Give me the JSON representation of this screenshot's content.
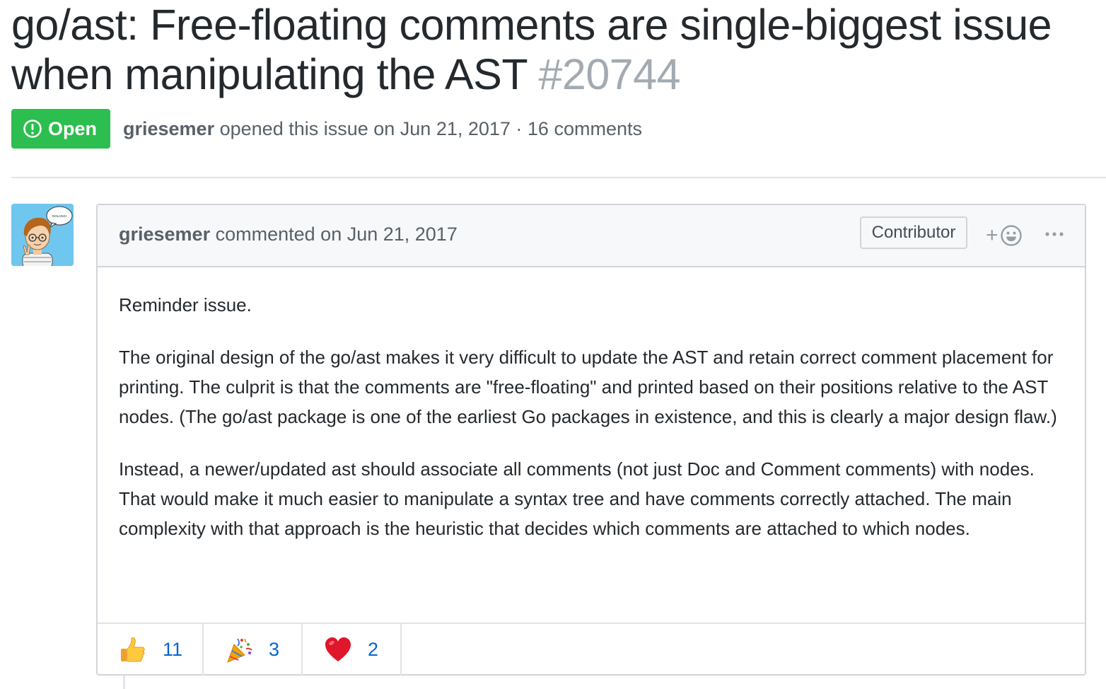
{
  "issue": {
    "title": "go/ast: Free-floating comments are single-biggest issue when manipulating the AST",
    "number": "#20744",
    "state": "Open",
    "author": "griesemer",
    "opened_text": "opened this issue on Jun 21, 2017 · 16 comments"
  },
  "comment": {
    "author": "griesemer",
    "commented_text": "commented on Jun 21, 2017",
    "role": "Contributor",
    "avatar_text": "GOLANG!",
    "add_reaction_label": "+",
    "paragraphs": [
      "Reminder issue.",
      "The original design of the go/ast makes it very difficult to update the AST and retain correct comment placement for printing. The culprit is that the comments are \"free-floating\" and printed based on their positions relative to the AST nodes. (The go/ast package is one of the earliest Go packages in existence, and this is clearly a major design flaw.)",
      "Instead, a newer/updated ast should associate all comments (not just Doc and Comment comments) with nodes. That would make it much easier to manipulate a syntax tree and have comments correctly attached. The main complexity with that approach is the heuristic that decides which comments are attached to which nodes."
    ],
    "reactions": [
      {
        "icon": "thumbs-up-icon",
        "count": "11"
      },
      {
        "icon": "party-popper-icon",
        "count": "3"
      },
      {
        "icon": "heart-icon",
        "count": "2"
      }
    ]
  },
  "colors": {
    "open_green": "#2cbe4e",
    "link_blue": "#0366d6",
    "muted_text": "#586069",
    "issue_number": "#a3aab1"
  }
}
